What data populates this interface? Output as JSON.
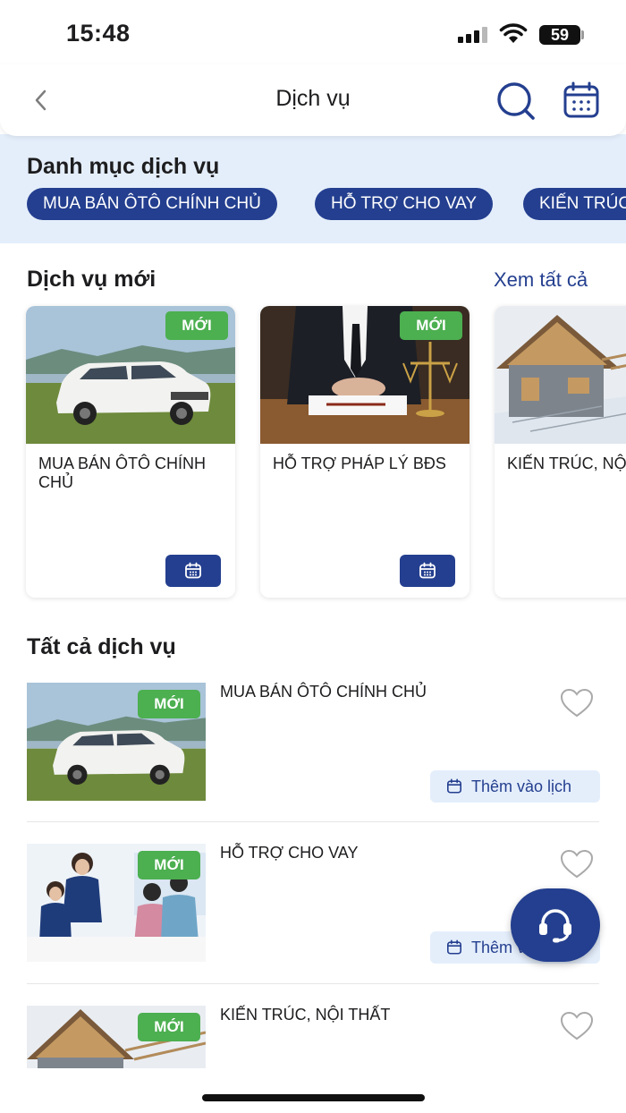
{
  "status_bar": {
    "time": "15:48",
    "battery": "59"
  },
  "header": {
    "title": "Dịch vụ",
    "icons": [
      "back-chevron-icon",
      "search-icon",
      "calendar-icon"
    ]
  },
  "categories": {
    "title": "Danh mục dịch vụ",
    "chips": [
      "MUA BÁN ÔTÔ CHÍNH CHỦ",
      "HỖ TRỢ CHO VAY",
      "KIẾN TRÚC"
    ]
  },
  "new_services": {
    "title": "Dịch vụ mới",
    "see_all": "Xem tất cả",
    "cards": [
      {
        "badge": "MỚI",
        "label": "MUA BÁN ÔTÔ CHÍNH CHỦ"
      },
      {
        "badge": "MỚI",
        "label": "HỖ TRỢ PHÁP LÝ BĐS"
      },
      {
        "badge": "",
        "label": "KIẾN TRÚC, NỘI THẤT"
      }
    ]
  },
  "all_services": {
    "title": "Tất cả dịch vụ",
    "items": [
      {
        "badge": "MỚI",
        "label": "MUA BÁN ÔTÔ CHÍNH CHỦ",
        "action": "Thêm vào lịch"
      },
      {
        "badge": "MỚI",
        "label": "HỖ TRỢ CHO VAY",
        "action": "Thêm vào lịch"
      },
      {
        "badge": "MỚI",
        "label": "KIẾN TRÚC, NỘI THẤT",
        "action": ""
      }
    ]
  },
  "colors": {
    "primary": "#243f8f",
    "badge_green": "#4caf50",
    "category_bg": "#e4eefb"
  }
}
